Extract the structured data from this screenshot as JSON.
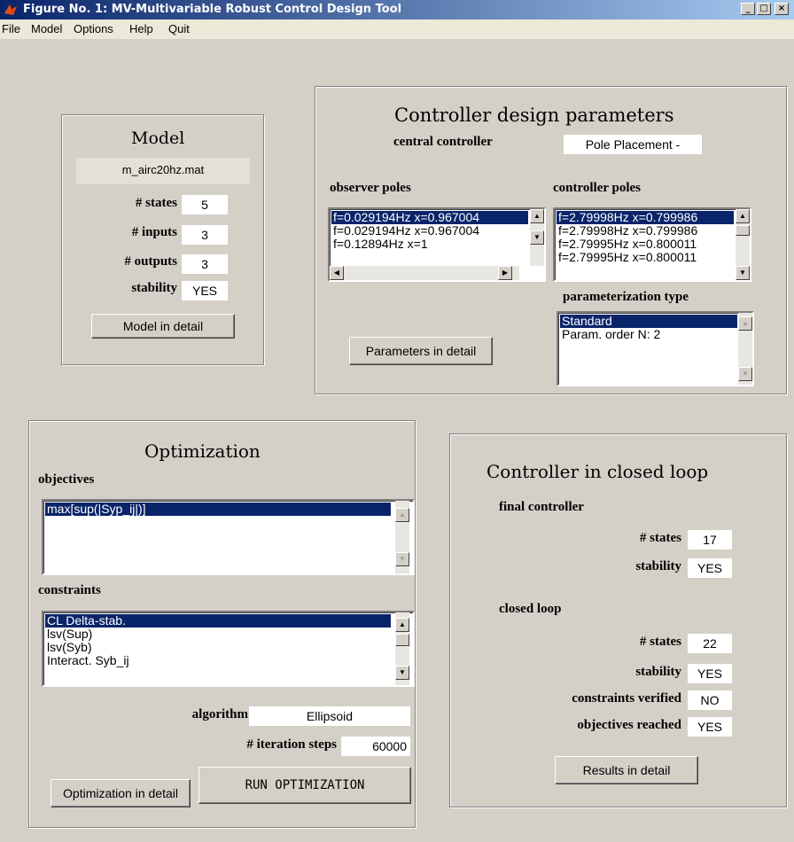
{
  "window": {
    "title": "Figure No. 1: MV-Multivariable Robust Control Design Tool"
  },
  "menu": [
    "File",
    "Model",
    "Options",
    "Help",
    "Quit"
  ],
  "model": {
    "title": "Model",
    "file": "m_airc20hz.mat",
    "states_label": "# states",
    "states": "5",
    "inputs_label": "# inputs",
    "inputs": "3",
    "outputs_label": "# outputs",
    "outputs": "3",
    "stability_label": "stability",
    "stability": "YES",
    "detail_button": "Model in detail"
  },
  "design": {
    "title": "Controller design parameters",
    "central_label": "central controller",
    "central_value": "Pole Placement -",
    "observer_label": "observer poles",
    "observer_items": [
      "f=0.029194Hz  x=0.967004",
      "f=0.029194Hz  x=0.967004",
      "f=0.12894Hz   x=1"
    ],
    "controller_label": "controller poles",
    "controller_items": [
      "f=2.79998Hz   x=0.799986",
      "f=2.79998Hz   x=0.799986",
      "f=2.79995Hz   x=0.800011",
      "f=2.79995Hz   x=0.800011"
    ],
    "param_type_label": "parameterization type",
    "param_items": [
      "Standard",
      "Param. order N: 2"
    ],
    "detail_button": "Parameters in detail"
  },
  "optimization": {
    "title": "Optimization",
    "objectives_label": "objectives",
    "objectives": [
      "max[sup(|Syp_ij|)]"
    ],
    "constraints_label": "constraints",
    "constraints": [
      "CL Delta-stab.",
      "lsv(Sup)",
      "lsv(Syb)",
      "Interact. Syb_ij"
    ],
    "algorithm_label": "algorithm",
    "algorithm": "Ellipsoid",
    "iter_label": "# iteration steps",
    "iter": "60000",
    "detail_button": "Optimization in detail",
    "run_button": "RUN OPTIMIZATION"
  },
  "closed": {
    "title": "Controller in closed loop",
    "final_label": "final controller",
    "fc_states_label": "# states",
    "fc_states": "17",
    "fc_stability_label": "stability",
    "fc_stability": "YES",
    "cl_label": "closed loop",
    "cl_states_label": "# states",
    "cl_states": "22",
    "cl_stability_label": "stability",
    "cl_stability": "YES",
    "constraints_label": "constraints verified",
    "constraints": "NO",
    "objectives_label": "objectives reached",
    "objectives": "YES",
    "detail_button": "Results in detail"
  }
}
